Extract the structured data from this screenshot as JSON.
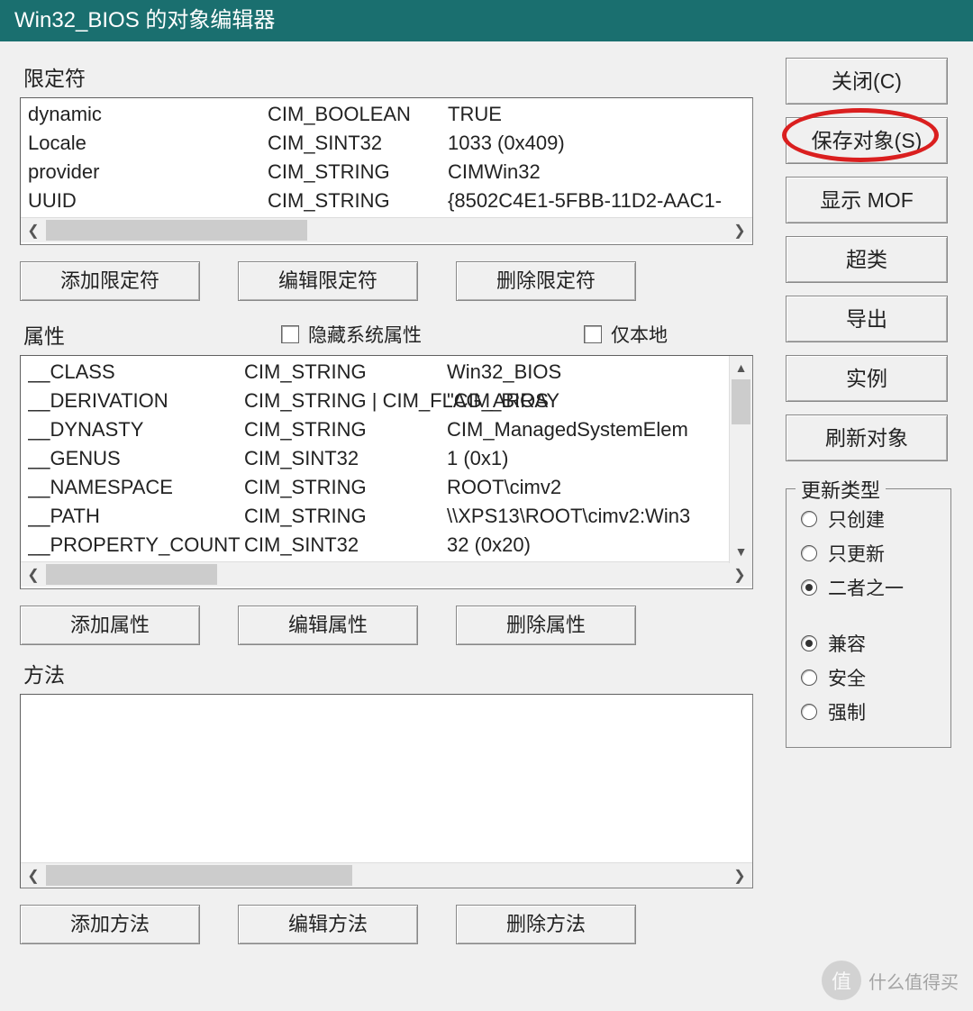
{
  "title": "Win32_BIOS 的对象编辑器",
  "sections": {
    "qualifiers_label": "限定符",
    "properties_label": "属性",
    "methods_label": "方法",
    "hide_system_props": "隐藏系统属性",
    "local_only": "仅本地"
  },
  "qualifiers": [
    {
      "name": "dynamic",
      "type": "CIM_BOOLEAN",
      "value": "TRUE"
    },
    {
      "name": "Locale",
      "type": "CIM_SINT32",
      "value": "1033 (0x409)"
    },
    {
      "name": "provider",
      "type": "CIM_STRING",
      "value": "CIMWin32"
    },
    {
      "name": "UUID",
      "type": "CIM_STRING",
      "value": "{8502C4E1-5FBB-11D2-AAC1-"
    }
  ],
  "properties": [
    {
      "name": "__CLASS",
      "type": "CIM_STRING",
      "value": "Win32_BIOS"
    },
    {
      "name": "__DERIVATION",
      "type": "CIM_STRING | CIM_FLAG_ARRAY",
      "value": "\"CIM_BIOS"
    },
    {
      "name": "__DYNASTY",
      "type": "CIM_STRING",
      "value": "CIM_ManagedSystemElem"
    },
    {
      "name": "__GENUS",
      "type": "CIM_SINT32",
      "value": "1 (0x1)"
    },
    {
      "name": "__NAMESPACE",
      "type": "CIM_STRING",
      "value": "ROOT\\cimv2"
    },
    {
      "name": "__PATH",
      "type": "CIM_STRING",
      "value": "\\\\XPS13\\ROOT\\cimv2:Win3"
    },
    {
      "name": "__PROPERTY_COUNT",
      "type": "CIM_SINT32",
      "value": "32 (0x20)"
    }
  ],
  "methods": [],
  "buttons": {
    "add_qualifier": "添加限定符",
    "edit_qualifier": "编辑限定符",
    "delete_qualifier": "删除限定符",
    "add_property": "添加属性",
    "edit_property": "编辑属性",
    "delete_property": "删除属性",
    "add_method": "添加方法",
    "edit_method": "编辑方法",
    "delete_method": "删除方法"
  },
  "side_buttons": {
    "close": "关闭(C)",
    "save_object": "保存对象(S)",
    "show_mof": "显示 MOF",
    "superclass": "超类",
    "export": "导出",
    "instance": "实例",
    "refresh_object": "刷新对象"
  },
  "update_type": {
    "legend": "更新类型",
    "create_only": "只创建",
    "update_only": "只更新",
    "either": "二者之一",
    "compatible": "兼容",
    "safe": "安全",
    "force": "强制",
    "selected_top": "either",
    "selected_bottom": "compatible"
  },
  "watermark": {
    "badge": "值",
    "text": "什么值得买"
  }
}
